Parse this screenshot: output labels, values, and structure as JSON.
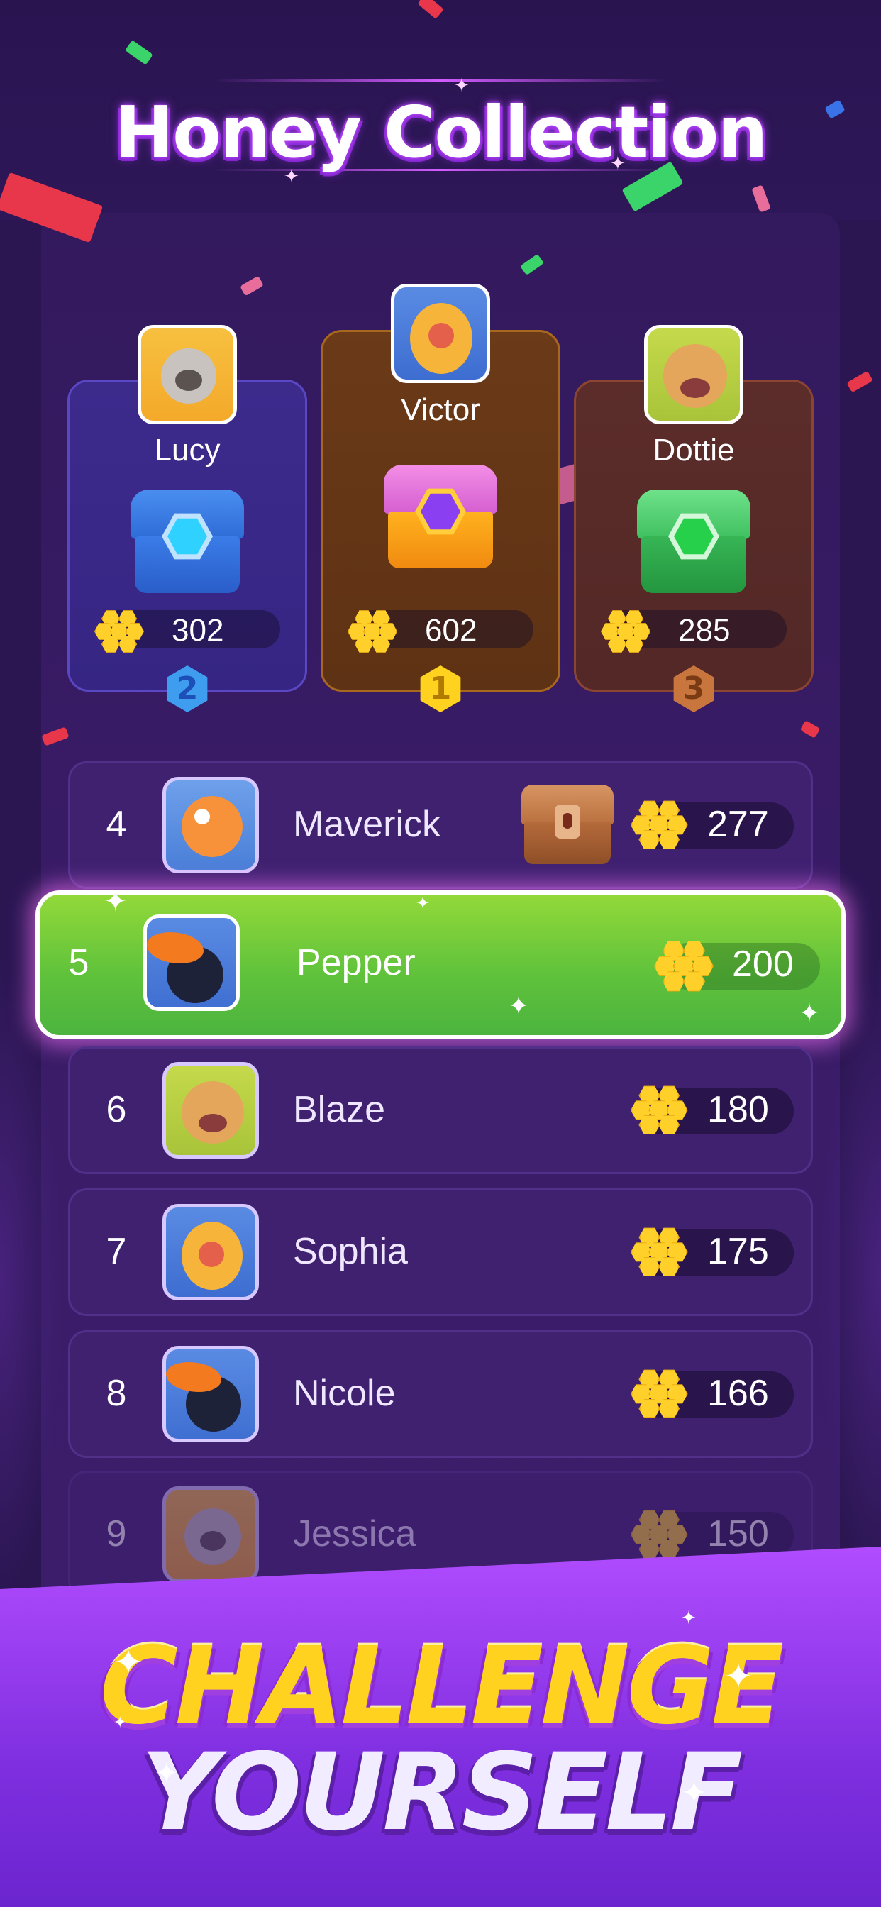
{
  "title": "Honey Collection",
  "podium": [
    {
      "rank": "2",
      "name": "Lucy",
      "score": "302",
      "avatar": "koala-avatar",
      "chest": "blue-chest"
    },
    {
      "rank": "1",
      "name": "Victor",
      "score": "602",
      "avatar": "parrot-avatar",
      "chest": "gold-chest"
    },
    {
      "rank": "3",
      "name": "Dottie",
      "score": "285",
      "avatar": "dog-avatar",
      "chest": "green-chest"
    }
  ],
  "leaderboard": [
    {
      "rank": "4",
      "name": "Maverick",
      "score": "277",
      "avatar": "clownfish-avatar",
      "has_chest": true
    },
    {
      "rank": "5",
      "name": "Pepper",
      "score": "200",
      "avatar": "toucan-avatar",
      "highlighted": true
    },
    {
      "rank": "6",
      "name": "Blaze",
      "score": "180",
      "avatar": "dog-avatar"
    },
    {
      "rank": "7",
      "name": "Sophia",
      "score": "175",
      "avatar": "parrot-avatar"
    },
    {
      "rank": "8",
      "name": "Nicole",
      "score": "166",
      "avatar": "toucan-avatar"
    },
    {
      "rank": "9",
      "name": "Jessica",
      "score": "150",
      "avatar": "koala-avatar",
      "faded": true
    }
  ],
  "banner": {
    "line1": "CHALLENGE",
    "line2": "YOURSELF"
  },
  "colors": {
    "background": "#2b1652",
    "highlight_row": "#61c33b",
    "honey": "#ffd02a",
    "banner": "#8a35e8",
    "gold_text": "#ffd21f"
  }
}
